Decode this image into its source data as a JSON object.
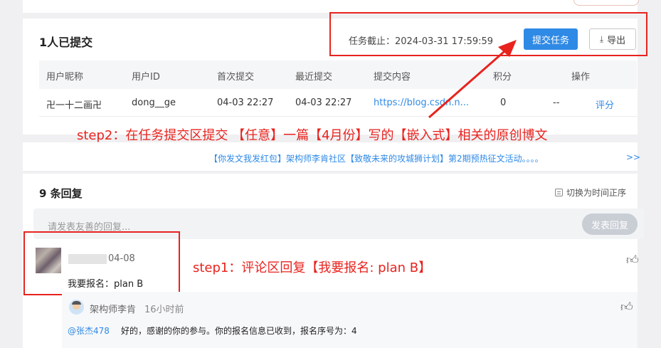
{
  "submission": {
    "title": "1人已提交",
    "deadline": "任务截止：2024-03-31 17:59:59",
    "submit_button": "提交任务",
    "export_button": "导出",
    "columns": [
      "用户昵称",
      "用户ID",
      "首次提交",
      "最近提交",
      "提交内容",
      "积分",
      "操作"
    ],
    "rows": [
      {
        "nickname": "卍一十二画卍",
        "user_id": "dong__ge",
        "first": "04-03 22:27",
        "latest": "04-03 22:27",
        "content": "https://blog.csdn.n...",
        "points": "0",
        "dash": "--",
        "action": "评分"
      }
    ]
  },
  "annotations": {
    "step2": "step2：在任务提交区提交 【任意】一篇【4月份】写的【嵌入式】相关的原创博文",
    "step1": "step1：评论区回复【我要报名: plan B】",
    "color": "#e8231e"
  },
  "banner": {
    "text": "【你发文我发红包】架构师李肯社区【致敬未来的攻城狮计划】第2期预热征文活动。。。。",
    "more": ">>"
  },
  "comments": {
    "title": "9 条回复",
    "sort_label": "切换为时间正序",
    "reply_placeholder": "请发表友善的回复...",
    "reply_button": "发表回复",
    "items": [
      {
        "date": "04-08",
        "text": "我要报名：plan B"
      }
    ],
    "sub_reply": {
      "author": "架构师李肯",
      "time": "16小时前",
      "mention": "@张杰478",
      "text": "好的，感谢的你的参与。你的报名信息已收到，报名序号为：4"
    }
  },
  "colors": {
    "accent": "#2f8ae6",
    "annotation": "#e8231e"
  }
}
